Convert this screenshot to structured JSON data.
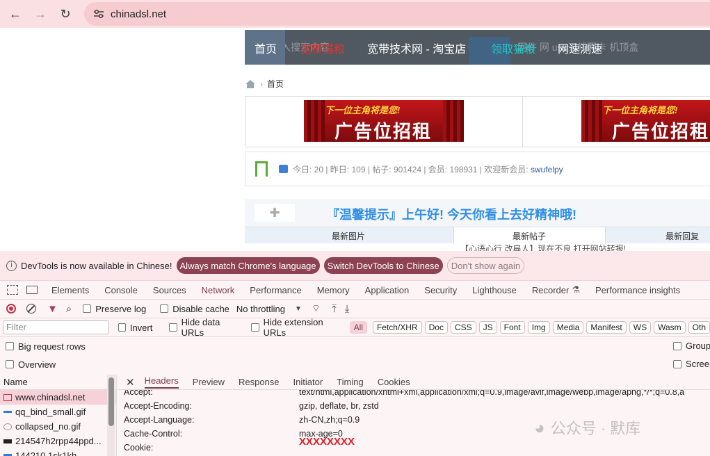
{
  "browser": {
    "url": "chinadsl.net"
  },
  "page": {
    "nav": {
      "home": "首页",
      "items": [
        "宽带猫粮",
        "宽带技术网 - 淘宝店",
        "领取猫粮",
        "网速测速"
      ],
      "ghost_search": "请输入搜索内容",
      "ghost_links": "网件  网  usb无线网卡  机顶盒"
    },
    "breadcrumb": "首页",
    "ads": {
      "banner_top": "下一位主角将是您!",
      "banner_main": "广告位招租"
    },
    "stats": {
      "text": "今日: 20 | 昨日: 109 | 帖子: 901424 | 会员: 198931 | 欢迎新会员: ",
      "new_member": "swufelpy"
    },
    "notice": "『温馨提示』上午好! 今天你看上去好精神哦!",
    "tabs": [
      "最新图片",
      "最新帖子",
      "最新回复"
    ],
    "peek_text": "【心语心行 改扁人】现在不良 打开网站转报!"
  },
  "devtools": {
    "infobar": {
      "message": "DevTools is now available in Chinese!",
      "btn_match": "Always match Chrome's language",
      "btn_switch": "Switch DevTools to Chinese",
      "btn_dismiss": "Don't show again"
    },
    "tabs": [
      "Elements",
      "Console",
      "Sources",
      "Network",
      "Performance",
      "Memory",
      "Application",
      "Security",
      "Lighthouse",
      "Recorder",
      "Performance insights"
    ],
    "network_bar": {
      "preserve_log": "Preserve log",
      "disable_cache": "Disable cache",
      "throttling": "No throttling"
    },
    "filter": {
      "placeholder": "Filter",
      "invert": "Invert",
      "hide_data": "Hide data URLs",
      "hide_ext": "Hide extension URLs",
      "chips": [
        "All",
        "Fetch/XHR",
        "Doc",
        "CSS",
        "JS",
        "Font",
        "Img",
        "Media",
        "Manifest",
        "WS",
        "Wasm",
        "Oth"
      ]
    },
    "options": {
      "big_rows": "Big request rows",
      "overview": "Overview",
      "group": "Group",
      "screenshots": "Screen"
    },
    "requests": {
      "header": "Name",
      "rows": [
        "www.chinadsl.net",
        "qq_bind_small.gif",
        "collapsed_no.gif",
        "214547h2rpp44ppd...",
        "144210 1sk1kh..."
      ]
    },
    "detail": {
      "tabs": [
        "Headers",
        "Preview",
        "Response",
        "Initiator",
        "Timing",
        "Cookies"
      ],
      "headers": [
        {
          "name": "Accept:",
          "value": "text/html,application/xhtml+xml,application/xml;q=0.9,image/avif,image/webp,image/apng,*/*;q=0.8,a"
        },
        {
          "name": "Accept-Encoding:",
          "value": "gzip, deflate, br, zstd"
        },
        {
          "name": "Accept-Language:",
          "value": "zh-CN,zh;q=0.9"
        },
        {
          "name": "Cache-Control:",
          "value": "max-age=0"
        },
        {
          "name": "Cookie:",
          "value": "XXXXXXXX"
        }
      ]
    },
    "watermark": "公众号 · 默库"
  }
}
